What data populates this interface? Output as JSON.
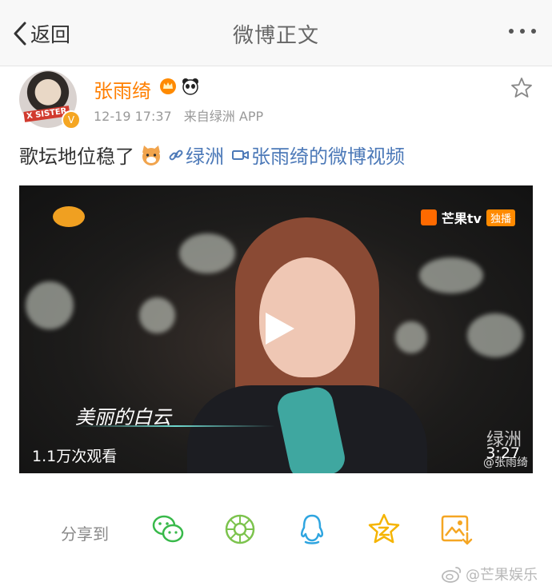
{
  "nav": {
    "back_label": "返回",
    "title": "微博正文"
  },
  "post": {
    "author": "张雨绮",
    "avatar_tag": "X SISTER",
    "timestamp": "12-19 17:37",
    "source": "来自绿洲 APP",
    "text": "歌坛地位稳了",
    "link_oasis": "绿洲",
    "link_video": "张雨绮的微博视频"
  },
  "video": {
    "channel_tag": "独播",
    "channel_name": "芒果tv",
    "lyric": "美丽的白云",
    "views": "1.1万次观看",
    "duration": "3:27",
    "oasis_mark": "绿洲",
    "watermark_user": "@张雨绮"
  },
  "share": {
    "label": "分享到",
    "targets": [
      "wechat-icon",
      "moments-icon",
      "qq-icon",
      "qzone-icon",
      "save-image-icon"
    ],
    "colors": {
      "wechat": "#38b94a",
      "moments": "#7cc34d",
      "qq": "#2fa5e0",
      "qzone": "#f5b400",
      "save": "#f5a623"
    }
  },
  "footer": {
    "watermark": "@芒果娱乐"
  },
  "colors": {
    "accent_orange": "#ff7f00",
    "link_blue": "#4c79b8",
    "meta_gray": "#999999"
  }
}
